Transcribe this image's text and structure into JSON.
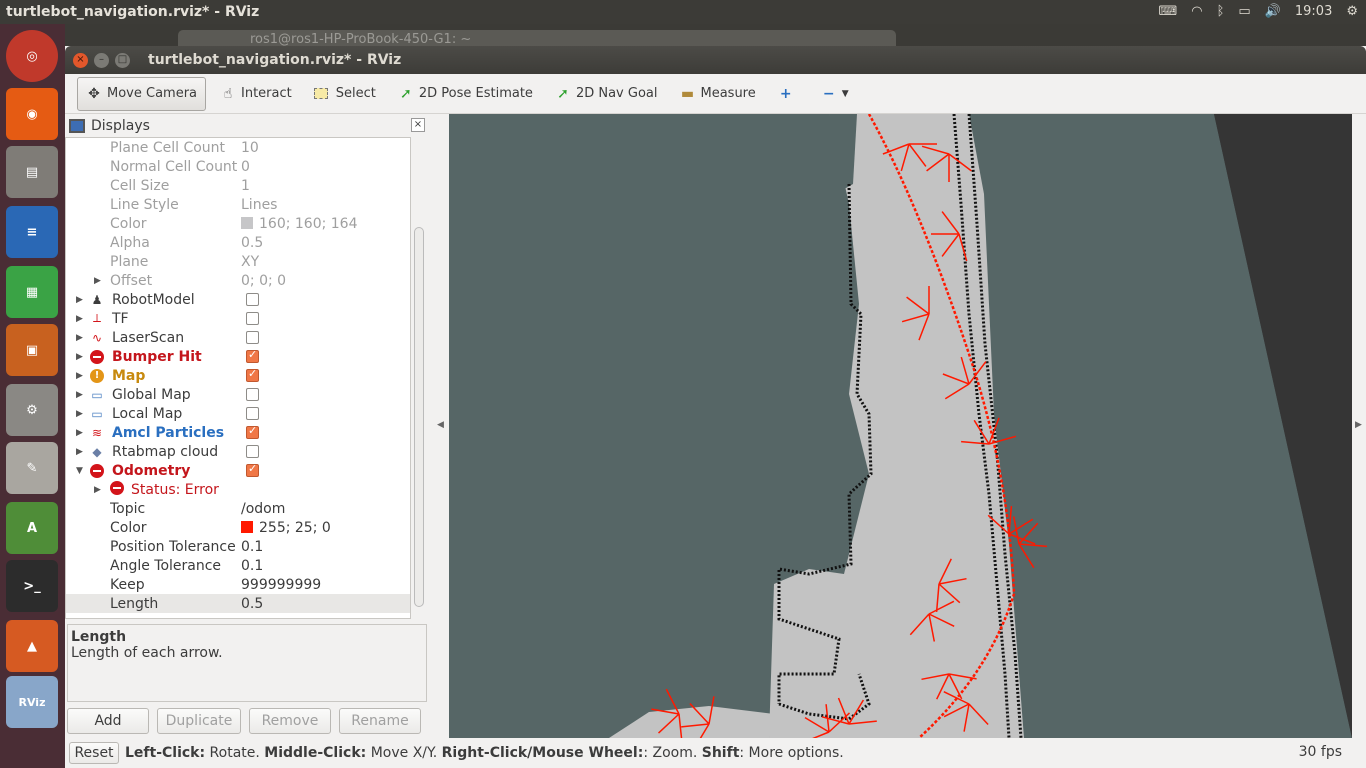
{
  "system": {
    "window_title": "turtlebot_navigation.rviz* - RViz",
    "clock": "19:03",
    "background_window_title": "ros1@ros1-HP-ProBook-450-G1: ~"
  },
  "window": {
    "title": "turtlebot_navigation.rviz* - RViz"
  },
  "toolbar": {
    "tools": [
      {
        "label": "Move Camera",
        "icon": "move-camera-icon",
        "active": true
      },
      {
        "label": "Interact",
        "icon": "hand-icon"
      },
      {
        "label": "Select",
        "icon": "select-icon"
      },
      {
        "label": "2D Pose Estimate",
        "icon": "green-arrow-icon"
      },
      {
        "label": "2D Nav Goal",
        "icon": "green-arrow-icon"
      },
      {
        "label": "Measure",
        "icon": "ruler-icon"
      }
    ]
  },
  "displays": {
    "title": "Displays",
    "rows": [
      {
        "type": "prop",
        "prop": "Plane Cell Count",
        "val": "10",
        "dim": true
      },
      {
        "type": "prop",
        "prop": "Normal Cell Count",
        "val": "0",
        "dim": true
      },
      {
        "type": "prop",
        "prop": "Cell Size",
        "val": "1",
        "dim": true
      },
      {
        "type": "prop",
        "prop": "Line Style",
        "val": "Lines",
        "dim": true
      },
      {
        "type": "prop",
        "prop": "Color",
        "val": "160; 160; 164",
        "dim": true,
        "swatch": "#a0a0a4"
      },
      {
        "type": "prop",
        "prop": "Alpha",
        "val": "0.5",
        "dim": true
      },
      {
        "type": "prop",
        "prop": "Plane",
        "val": "XY",
        "dim": true
      },
      {
        "type": "prop",
        "prop": "Offset",
        "val": "0; 0; 0",
        "dim": true,
        "expand": true
      },
      {
        "type": "display",
        "name": "RobotModel",
        "icon": "robot-icon",
        "checked": false
      },
      {
        "type": "display",
        "name": "TF",
        "icon": "axes-icon",
        "checked": false
      },
      {
        "type": "display",
        "name": "LaserScan",
        "icon": "laser-icon",
        "checked": false
      },
      {
        "type": "display",
        "name": "Bumper Hit",
        "icon": "error-icon",
        "checked": true,
        "status": "err"
      },
      {
        "type": "display",
        "name": "Map",
        "icon": "warning-icon",
        "checked": true,
        "status": "warn"
      },
      {
        "type": "display",
        "name": "Global Map",
        "icon": "folder-icon",
        "checked": false
      },
      {
        "type": "display",
        "name": "Local Map",
        "icon": "folder-icon",
        "checked": false
      },
      {
        "type": "display",
        "name": "Amcl Particles",
        "icon": "particles-icon",
        "checked": true,
        "status": "blue"
      },
      {
        "type": "display",
        "name": "Rtabmap cloud",
        "icon": "cloud-icon",
        "checked": false
      },
      {
        "type": "display",
        "name": "Odometry",
        "icon": "error-icon",
        "checked": true,
        "status": "err",
        "expanded": true
      },
      {
        "type": "status",
        "name": "Status: Error"
      },
      {
        "type": "prop",
        "prop": "Topic",
        "val": "/odom"
      },
      {
        "type": "prop",
        "prop": "Color",
        "val": "255; 25; 0",
        "swatch": "#ff1900"
      },
      {
        "type": "prop",
        "prop": "Position Tolerance",
        "val": "0.1"
      },
      {
        "type": "prop",
        "prop": "Angle Tolerance",
        "val": "0.1"
      },
      {
        "type": "prop",
        "prop": "Keep",
        "val": "999999999"
      },
      {
        "type": "prop",
        "prop": "Length",
        "val": "0.5",
        "selected": true
      }
    ],
    "description": {
      "title": "Length",
      "text": "Length of each arrow."
    },
    "buttons": {
      "add": "Add",
      "duplicate": "Duplicate",
      "remove": "Remove",
      "rename": "Rename"
    }
  },
  "status": {
    "reset": "Reset",
    "help_left_bold": "Left-Click:",
    "help_left": " Rotate. ",
    "help_middle_bold": "Middle-Click:",
    "help_middle": " Move X/Y. ",
    "help_right_bold": "Right-Click/Mouse Wheel:",
    "help_right": ": Zoom. ",
    "help_shift_bold": "Shift",
    "help_shift": ": More options.",
    "fps": "30 fps"
  },
  "colors": {
    "viewport_bg": "#566666",
    "odom_arrow": "#ff1900",
    "error": "#c4161c"
  }
}
